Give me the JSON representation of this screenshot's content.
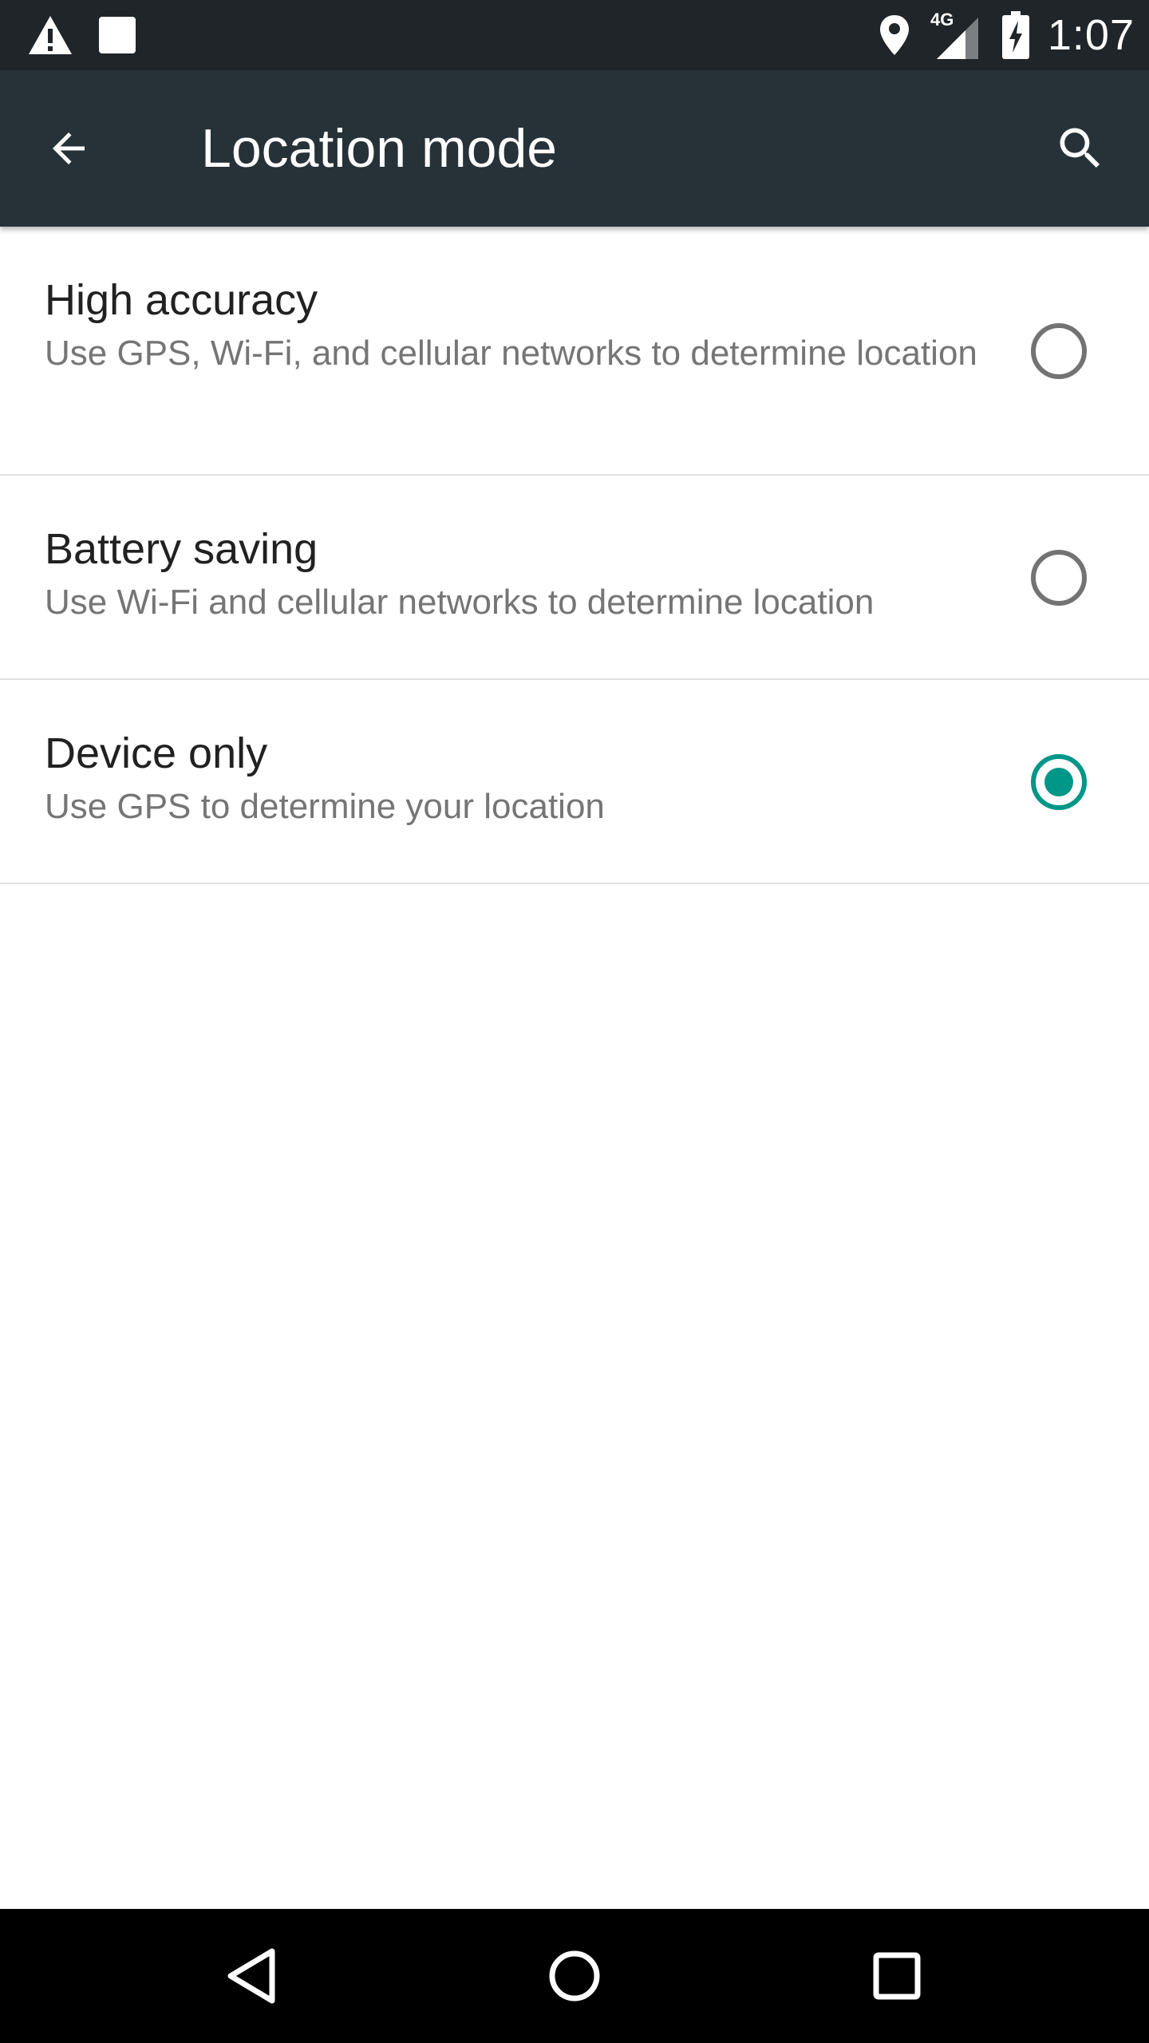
{
  "status_bar": {
    "time": "1:07",
    "network_label": "4G",
    "icons": [
      "warning-icon",
      "notification-square-icon",
      "location-pin-icon",
      "signal-4g-icon",
      "battery-charging-icon"
    ]
  },
  "app_bar": {
    "title": "Location mode",
    "back_icon": "arrow-back-icon",
    "search_icon": "search-icon",
    "background": "#263238"
  },
  "options": [
    {
      "title": "High accuracy",
      "summary": "Use GPS, Wi-Fi, and cellular networks to determine location",
      "selected": false
    },
    {
      "title": "Battery saving",
      "summary": "Use Wi-Fi and cellular networks to determine location",
      "selected": false
    },
    {
      "title": "Device only",
      "summary": "Use GPS to determine your location",
      "selected": true
    }
  ],
  "nav_bar": {
    "buttons": [
      "back-triangle-icon",
      "home-circle-icon",
      "recents-square-icon"
    ]
  },
  "colors": {
    "accent": "#009688",
    "status_bar": "#1f2529",
    "divider": "#e0e0e0"
  }
}
